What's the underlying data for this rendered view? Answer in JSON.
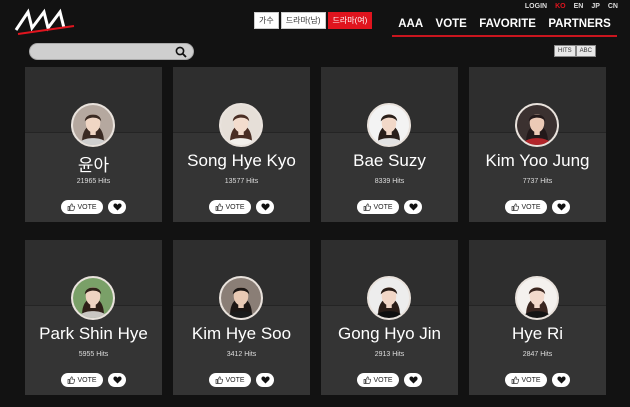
{
  "header": {
    "languages": [
      {
        "label": "LOGIN",
        "active": false
      },
      {
        "label": "KO",
        "active": true
      },
      {
        "label": "EN",
        "active": false
      },
      {
        "label": "JP",
        "active": false
      },
      {
        "label": "CN",
        "active": false
      }
    ],
    "categories": [
      {
        "label": "가수",
        "active": false
      },
      {
        "label": "드라마(남)",
        "active": false
      },
      {
        "label": "드라마(여)",
        "active": true
      }
    ],
    "nav": [
      "AAA",
      "VOTE",
      "FAVORITE",
      "PARTNERS"
    ],
    "accent_color": "#e0141e"
  },
  "search": {
    "placeholder": ""
  },
  "sort": [
    "HITS",
    "ABC"
  ],
  "cards": [
    {
      "name": "윤아",
      "hits": "21965 Hits",
      "vote_label": "VOTE",
      "colors": {
        "bg": "#b5a89f",
        "hair": "#3a2a22",
        "skin": "#f0d6c4",
        "cloth": "#cfcfcf"
      }
    },
    {
      "name": "Song Hye Kyo",
      "hits": "13577 Hits",
      "vote_label": "VOTE",
      "colors": {
        "bg": "#e6dfd8",
        "hair": "#4a2e24",
        "skin": "#f3dccd",
        "cloth": "#f3f0ec"
      }
    },
    {
      "name": "Bae Suzy",
      "hits": "8339 Hits",
      "vote_label": "VOTE",
      "colors": {
        "bg": "#f3f3f3",
        "hair": "#2a1f1a",
        "skin": "#f2d8c8",
        "cloth": "#e2e2e2"
      }
    },
    {
      "name": "Kim Yoo Jung",
      "hits": "7737 Hits",
      "vote_label": "VOTE",
      "colors": {
        "bg": "#3b3130",
        "hair": "#23191a",
        "skin": "#eccab6",
        "cloth": "#b2262b"
      }
    },
    {
      "name": "Park Shin Hye",
      "hits": "5955 Hits",
      "vote_label": "VOTE",
      "colors": {
        "bg": "#7aa068",
        "hair": "#2f2018",
        "skin": "#efd3c1",
        "cloth": "#c9c6c2"
      }
    },
    {
      "name": "Kim Hye Soo",
      "hits": "3412 Hits",
      "vote_label": "VOTE",
      "colors": {
        "bg": "#8a7e76",
        "hair": "#1c1614",
        "skin": "#e8c9b4",
        "cloth": "#1a1a1a"
      }
    },
    {
      "name": "Gong Hyo Jin",
      "hits": "2913 Hits",
      "vote_label": "VOTE",
      "colors": {
        "bg": "#ededed",
        "hair": "#2a1d17",
        "skin": "#f1d6c6",
        "cloth": "#0f0f0f"
      }
    },
    {
      "name": "Hye Ri",
      "hits": "2847 Hits",
      "vote_label": "VOTE",
      "colors": {
        "bg": "#f4f1ee",
        "hair": "#3a2620",
        "skin": "#f2d9cb",
        "cloth": "#141414"
      }
    }
  ]
}
